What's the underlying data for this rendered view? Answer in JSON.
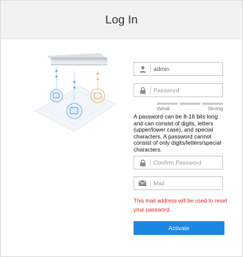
{
  "header": {
    "title": "Log In"
  },
  "form": {
    "username": {
      "value": "admin",
      "placeholder": ""
    },
    "password": {
      "value": "",
      "placeholder": "Password"
    },
    "strength": {
      "weak_label": "Weak",
      "strong_label": "Strong"
    },
    "password_hint": "A password can be 8-16 bits long and can consist of digits, letters (upper/lower case), and special characters. A password cannot consist of only digits/letters/special characters.",
    "confirm_password": {
      "value": "",
      "placeholder": "Confirm Password"
    },
    "mail": {
      "value": "",
      "placeholder": "Mail"
    },
    "mail_note": "This mail address will be used to reset your password.",
    "activate_label": "Activate"
  },
  "colors": {
    "header_bg": "#f2f2f2",
    "accent": "#1c86e3",
    "warning": "#e02424",
    "illustration_blue": "#6aa6e6",
    "illustration_orange": "#e9b56a"
  },
  "icons": {
    "username": "user-icon",
    "password": "lock-icon",
    "confirm_password": "lock-icon",
    "mail": "mail-icon",
    "illustration": "device-network-illustration"
  }
}
